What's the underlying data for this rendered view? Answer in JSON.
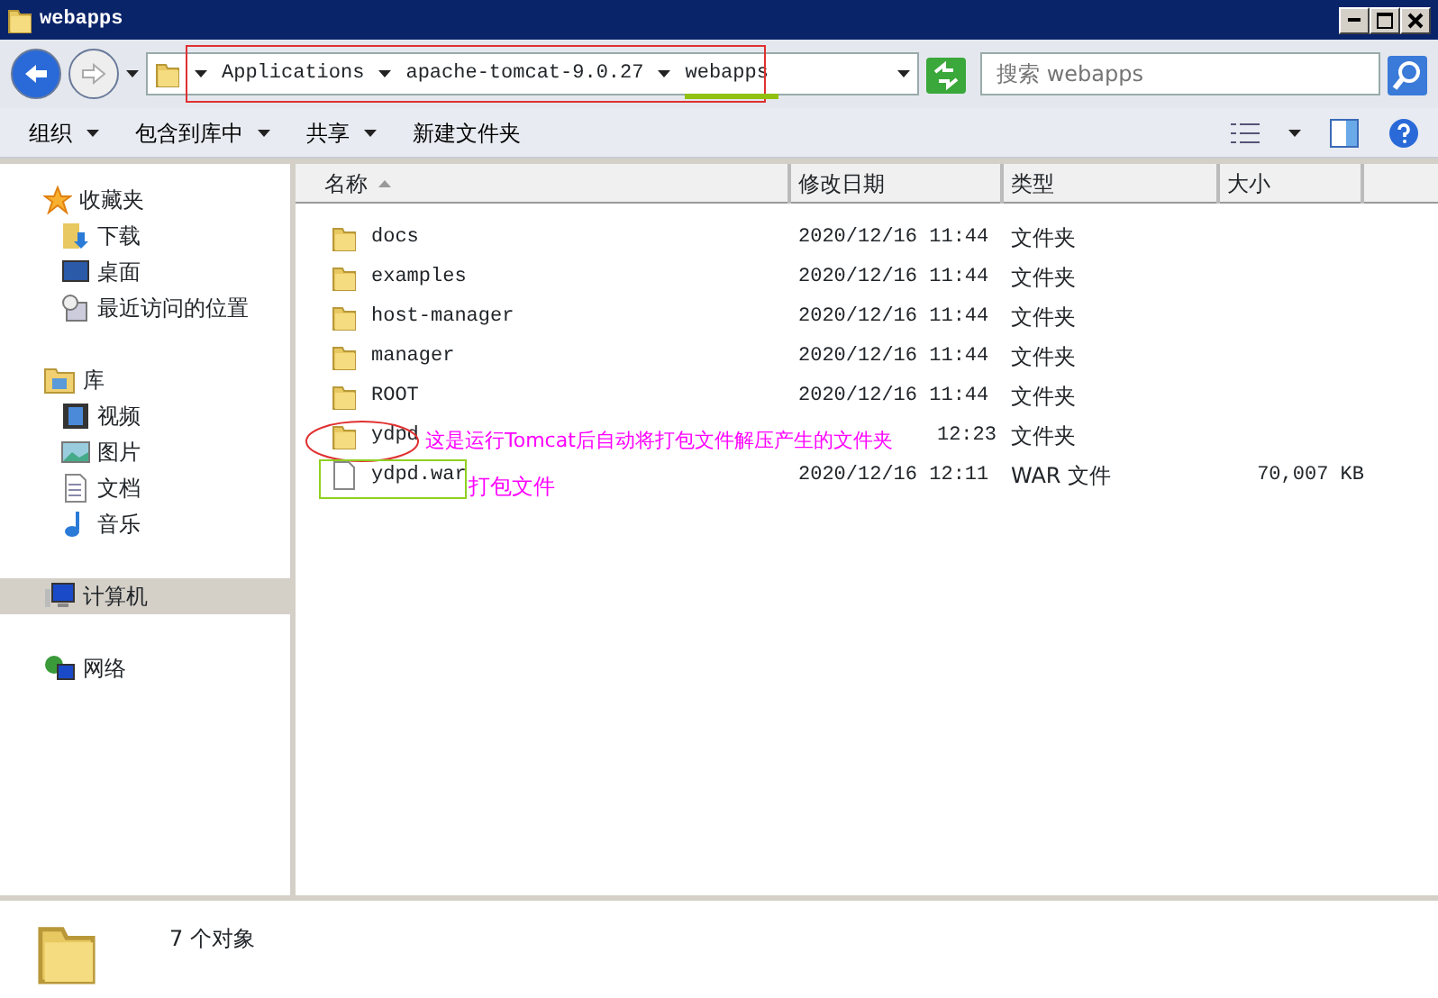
{
  "window": {
    "title": "webapps"
  },
  "breadcrumb": [
    {
      "label": "Applications"
    },
    {
      "label": "apache-tomcat-9.0.27"
    },
    {
      "label": "webapps"
    }
  ],
  "search": {
    "placeholder": "搜索 webapps"
  },
  "toolbar": [
    {
      "label": "组织",
      "dropdown": true
    },
    {
      "label": "包含到库中",
      "dropdown": true
    },
    {
      "label": "共享",
      "dropdown": true
    },
    {
      "label": "新建文件夹",
      "dropdown": false
    }
  ],
  "sidebar": {
    "groups": [
      {
        "label": "收藏夹",
        "selected": false,
        "children": [
          {
            "label": "下载",
            "selected": false
          },
          {
            "label": "桌面",
            "selected": false
          },
          {
            "label": "最近访问的位置",
            "selected": false
          }
        ]
      },
      {
        "label": "库",
        "selected": false,
        "children": [
          {
            "label": "视频",
            "selected": false
          },
          {
            "label": "图片",
            "selected": false
          },
          {
            "label": "文档",
            "selected": false
          },
          {
            "label": "音乐",
            "selected": false
          }
        ]
      },
      {
        "label": "计算机",
        "selected": true
      },
      {
        "label": "网络",
        "selected": false
      }
    ]
  },
  "table": {
    "columns": [
      {
        "label": "名称",
        "sorted": true
      },
      {
        "label": "修改日期",
        "sorted": false
      },
      {
        "label": "类型",
        "sorted": false
      },
      {
        "label": "大小",
        "sorted": false
      }
    ],
    "rows": [
      {
        "kind": "folder",
        "name": "docs",
        "date": "2020/12/16 11:44",
        "type": "文件夹"
      },
      {
        "kind": "folder",
        "name": "examples",
        "date": "2020/12/16 11:44",
        "type": "文件夹"
      },
      {
        "kind": "folder",
        "name": "host-manager",
        "date": "2020/12/16 11:44",
        "type": "文件夹"
      },
      {
        "kind": "folder",
        "name": "manager",
        "date": "2020/12/16 11:44",
        "type": "文件夹"
      },
      {
        "kind": "folder",
        "name": "ROOT",
        "date": "2020/12/16 11:44",
        "type": "文件夹"
      },
      {
        "kind": "folder",
        "name": "ydpd",
        "date": "12:23",
        "type": "文件夹",
        "note": "这是运行Tomcat后自动将打包文件解压产生的文件夹"
      },
      {
        "kind": "file",
        "name": "ydpd.war",
        "date": "2020/12/16 12:11",
        "type": "WAR 文件",
        "size": "70,007 KB",
        "note": "打包文件"
      }
    ]
  },
  "status_bar": {
    "count": "7 个对象"
  }
}
